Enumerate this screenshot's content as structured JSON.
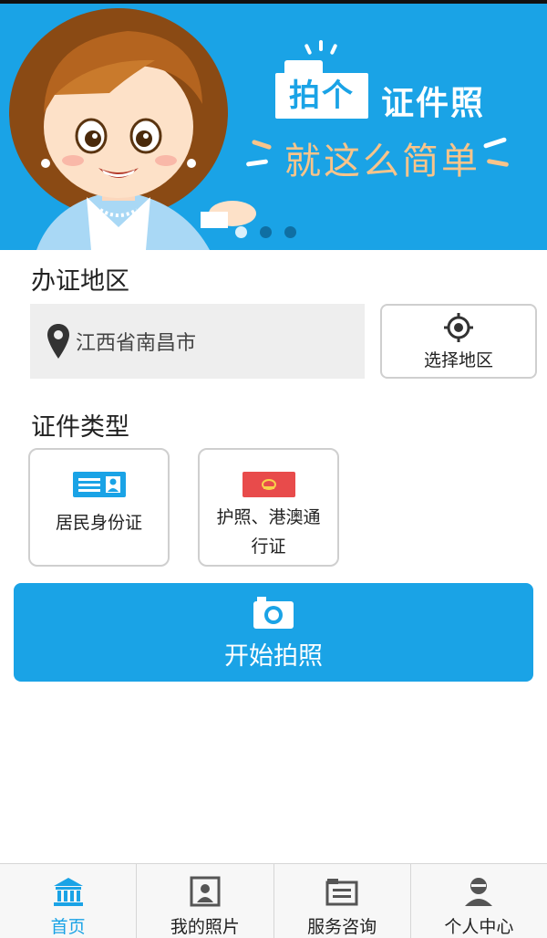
{
  "banner": {
    "slogan_box": "拍个",
    "slogan_title": "证件照",
    "slogan_sub": "就这么简单",
    "carousel_count": 3,
    "carousel_active": 1
  },
  "region": {
    "title": "办证地区",
    "location_value": "江西省南昌市",
    "select_button": "选择地区"
  },
  "doc_types": {
    "title": "证件类型",
    "items": [
      {
        "label": "居民身份证",
        "icon": "id-card-icon"
      },
      {
        "label": "护照、港澳通行证",
        "icon": "passport-icon"
      }
    ]
  },
  "start_button": {
    "label": "开始拍照",
    "icon": "camera-icon"
  },
  "tabbar": {
    "items": [
      {
        "label": "首页",
        "icon": "bank-icon",
        "active": true
      },
      {
        "label": "我的照片",
        "icon": "photo-icon",
        "active": false
      },
      {
        "label": "服务咨询",
        "icon": "consult-icon",
        "active": false
      },
      {
        "label": "个人中心",
        "icon": "user-icon",
        "active": false
      }
    ]
  },
  "colors": {
    "accent": "#1aa3e6",
    "slogan_sub": "#f8c48a",
    "passport_red": "#e84b4b"
  }
}
